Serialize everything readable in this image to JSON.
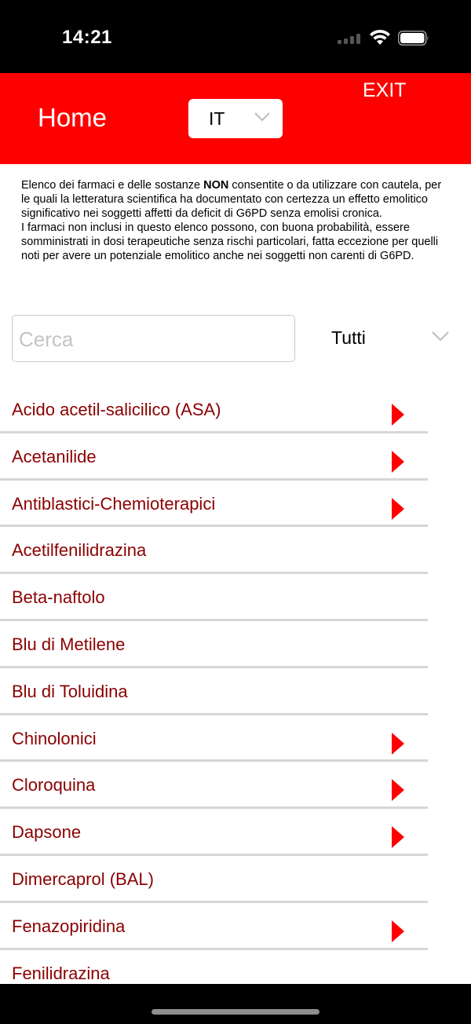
{
  "status_bar": {
    "time": "14:21"
  },
  "header": {
    "title": "Home",
    "exit_label": "EXIT",
    "language": "IT",
    "color": "#ff0000"
  },
  "intro": {
    "line1_before": "Elenco dei farmaci e delle sostanze ",
    "line1_bold": "NON",
    "line1_after": " consentite o da utilizzare con cautela, per le quali la letteratura scientifica ha documentato con certezza un effetto emolitico significativo nei soggetti affetti da deficit di G6PD senza emolisi cronica.",
    "paragraph2": "I farmaci non inclusi in questo elenco possono, con buona probabilità, essere somministrati in dosi terapeutiche senza rischi particolari, fatta eccezione per quelli noti per avere un potenziale emolitico anche nei soggetti non carenti di G6PD."
  },
  "search": {
    "placeholder": "Cerca",
    "value": ""
  },
  "filter": {
    "selected": "Tutti"
  },
  "items": [
    {
      "label": "Acido acetil-salicilico (ASA)",
      "has_detail": true
    },
    {
      "label": "Acetanilide",
      "has_detail": true
    },
    {
      "label": "Antiblastici-Chemioterapici",
      "has_detail": true
    },
    {
      "label": "Acetilfenilidrazina",
      "has_detail": false
    },
    {
      "label": "Beta-naftolo",
      "has_detail": false
    },
    {
      "label": "Blu di Metilene",
      "has_detail": false
    },
    {
      "label": "Blu di Toluidina",
      "has_detail": false
    },
    {
      "label": "Chinolonici",
      "has_detail": true
    },
    {
      "label": "Cloroquina",
      "has_detail": true
    },
    {
      "label": "Dapsone",
      "has_detail": true
    },
    {
      "label": "Dimercaprol (BAL)",
      "has_detail": false
    },
    {
      "label": "Fenazopiridina",
      "has_detail": true
    },
    {
      "label": "Fenilidrazina",
      "has_detail": false
    }
  ],
  "colors": {
    "item_text": "#8b0000",
    "arrow": "#ff0000",
    "divider": "#d6d6d6"
  }
}
